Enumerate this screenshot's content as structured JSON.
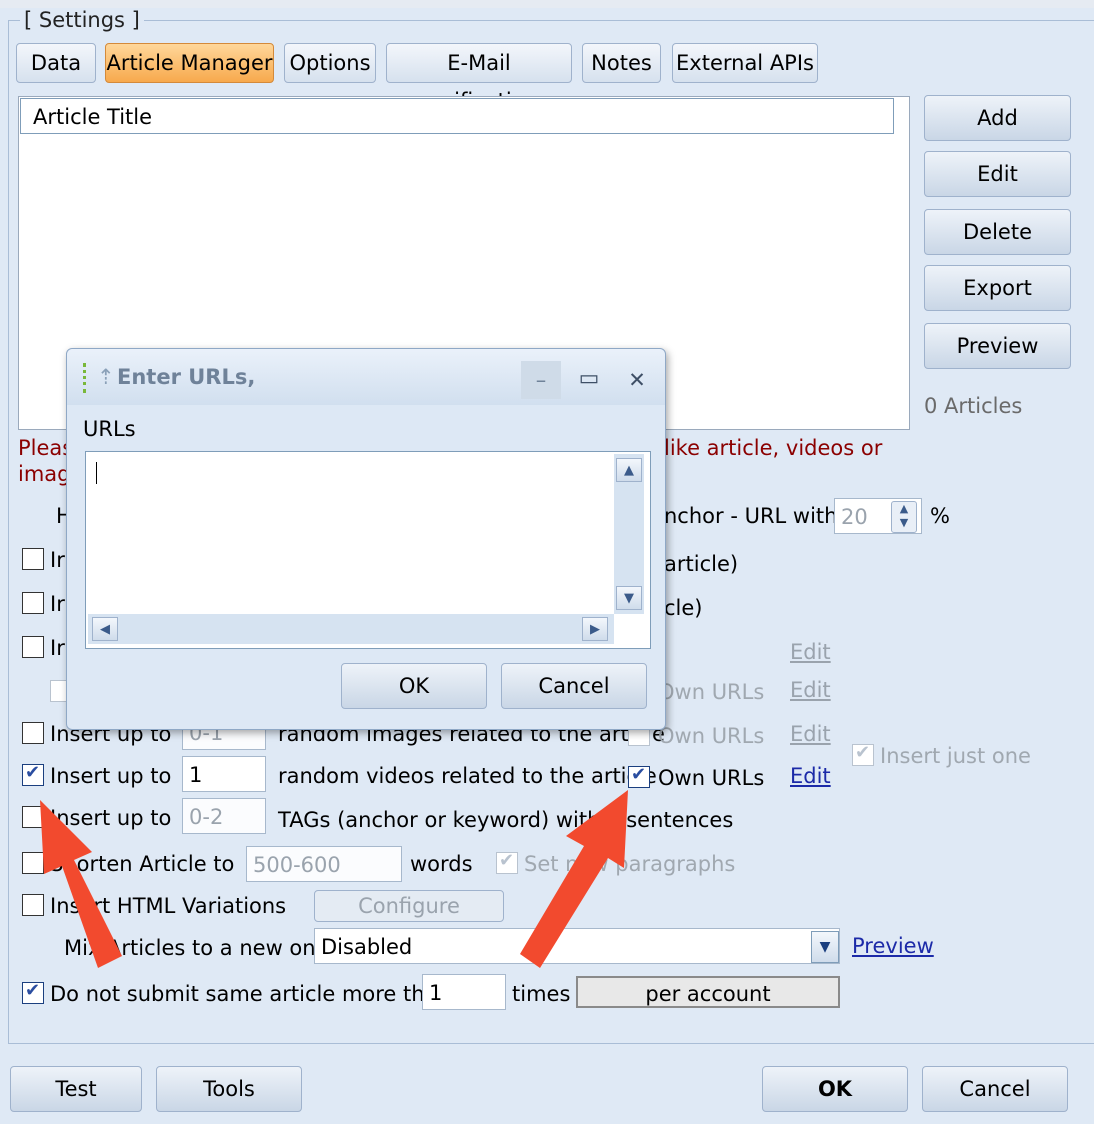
{
  "window": {
    "group_title": "[ Settings ]"
  },
  "tabs": [
    {
      "label": "Data"
    },
    {
      "label": "Article Manager",
      "active": true
    },
    {
      "label": "Options"
    },
    {
      "label": "E-Mail verification"
    },
    {
      "label": "Notes"
    },
    {
      "label": "External APIs"
    }
  ],
  "article_list": {
    "column_header": "Article Title",
    "count_text": "0 Articles"
  },
  "side_buttons": {
    "add": "Add",
    "edit": "Edit",
    "delete": "Delete",
    "export": "Export",
    "preview": "Preview"
  },
  "hint": {
    "line1_left": "Pleas",
    "line1_right": "like article, videos or",
    "line2_left": "image"
  },
  "anchor_row": {
    "left_fragment": "H",
    "right_text": "nchor - URL with",
    "value": "20",
    "unit": "%"
  },
  "partial_rows": {
    "row1_left": "Ir",
    "row1_right": "article)",
    "row2_left": "Ir",
    "row2_right": "cle)",
    "row3_left": "Ir",
    "row3_edit": "Edit",
    "row4_own": "Own URLs",
    "row4_edit": "Edit"
  },
  "images_row": {
    "label": "Insert up to",
    "value": "0-1",
    "text": "random images related to the article",
    "own_urls": "Own URLs",
    "edit": "Edit",
    "insert_just_one": "Insert just one"
  },
  "videos_row": {
    "label": "Insert up to",
    "value": "1",
    "text": "random videos related to the article",
    "own_urls": "Own URLs",
    "edit": "Edit",
    "checked": true,
    "own_checked": true
  },
  "tags_row": {
    "label": "Insert up to",
    "value": "0-2",
    "text": "TAGs (anchor or keyword) within sentences"
  },
  "shorten_row": {
    "label": "Shorten Article to",
    "value": "500-600",
    "words": "words",
    "set_paragraphs": "Set new paragraphs"
  },
  "html_row": {
    "label": "Insert HTML Variations",
    "configure": "Configure"
  },
  "mix_row": {
    "label": "Mix Articles to a new one",
    "selected": "Disabled",
    "preview": "Preview"
  },
  "submit_row": {
    "label": "Do not submit same article more than",
    "value": "1",
    "times": "times",
    "per_button": "per account"
  },
  "bottom_buttons": {
    "test": "Test",
    "tools": "Tools",
    "ok": "OK",
    "cancel": "Cancel"
  },
  "dialog": {
    "title": "Enter URLs,",
    "field_label": "URLs",
    "value": "",
    "ok": "OK",
    "cancel": "Cancel"
  },
  "annotation_color": "#f24a2e"
}
